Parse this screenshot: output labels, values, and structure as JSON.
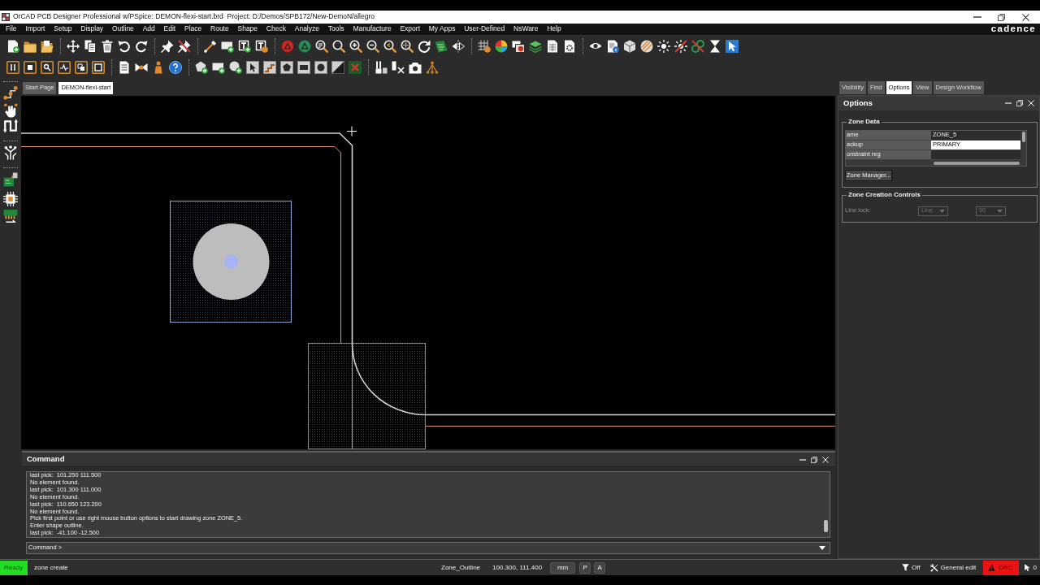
{
  "window": {
    "title": "OrCAD PCB Designer Professional w/PSpice: DEMON-flexi-start.brd  Project: D:/Demos/SPB172/New-DemoN/allegro"
  },
  "menu": {
    "items": [
      "File",
      "Import",
      "Setup",
      "Display",
      "Outline",
      "Add",
      "Edit",
      "Place",
      "Route",
      "Shape",
      "Check",
      "Analyze",
      "Tools",
      "Manufacture",
      "Export",
      "My Apps",
      "User-Defined",
      "NsWare",
      "Help"
    ],
    "brand": "cadence"
  },
  "document_tabs": [
    {
      "label": "Start Page",
      "selected": false
    },
    {
      "label": "DEMON-flexi-start",
      "selected": true
    }
  ],
  "panel_tabs": [
    {
      "label": "Visibility",
      "selected": false
    },
    {
      "label": "Find",
      "selected": false
    },
    {
      "label": "Options",
      "selected": true
    },
    {
      "label": "View",
      "selected": false
    },
    {
      "label": "Design Workflow",
      "selected": false
    }
  ],
  "options_panel": {
    "title": "Options",
    "zone_data": {
      "title": "Zone Data",
      "properties": [
        {
          "name": "ame",
          "value": "ZONE_5",
          "selected": false
        },
        {
          "name": "ackup",
          "value": "PRIMARY",
          "selected": true
        },
        {
          "name": "onstraint reg",
          "selected": false
        }
      ],
      "button": "Zone Manager..."
    },
    "zone_creation_controls": {
      "title": "Zone Creation Controls",
      "line_lock": {
        "label": "Line lock:",
        "mode": "Line",
        "angle": "90",
        "disabled": true
      }
    }
  },
  "command": {
    "title": "Command",
    "log": [
      "last pick:  101.250 111.500",
      "No element found.",
      "last pick:  101.300 111.000",
      "No element found.",
      "last pick:  110.650 123.200",
      "No element found.",
      "Pick first point or use right mouse button options to start drawing zone ZONE_5.",
      "Enter shape outline.",
      "last pick:  -41.100 -12.500"
    ],
    "prompt": "Command >"
  },
  "status_bar": {
    "state": "Ready",
    "command": "zone create",
    "object_class": "Zone_Outline",
    "coordinates": "100.300, 111.400",
    "units": "mm",
    "toggles": [
      "P",
      "A"
    ],
    "filter": "Off",
    "mode": "General edit",
    "drc": "DRC",
    "selection_count": "0"
  }
}
